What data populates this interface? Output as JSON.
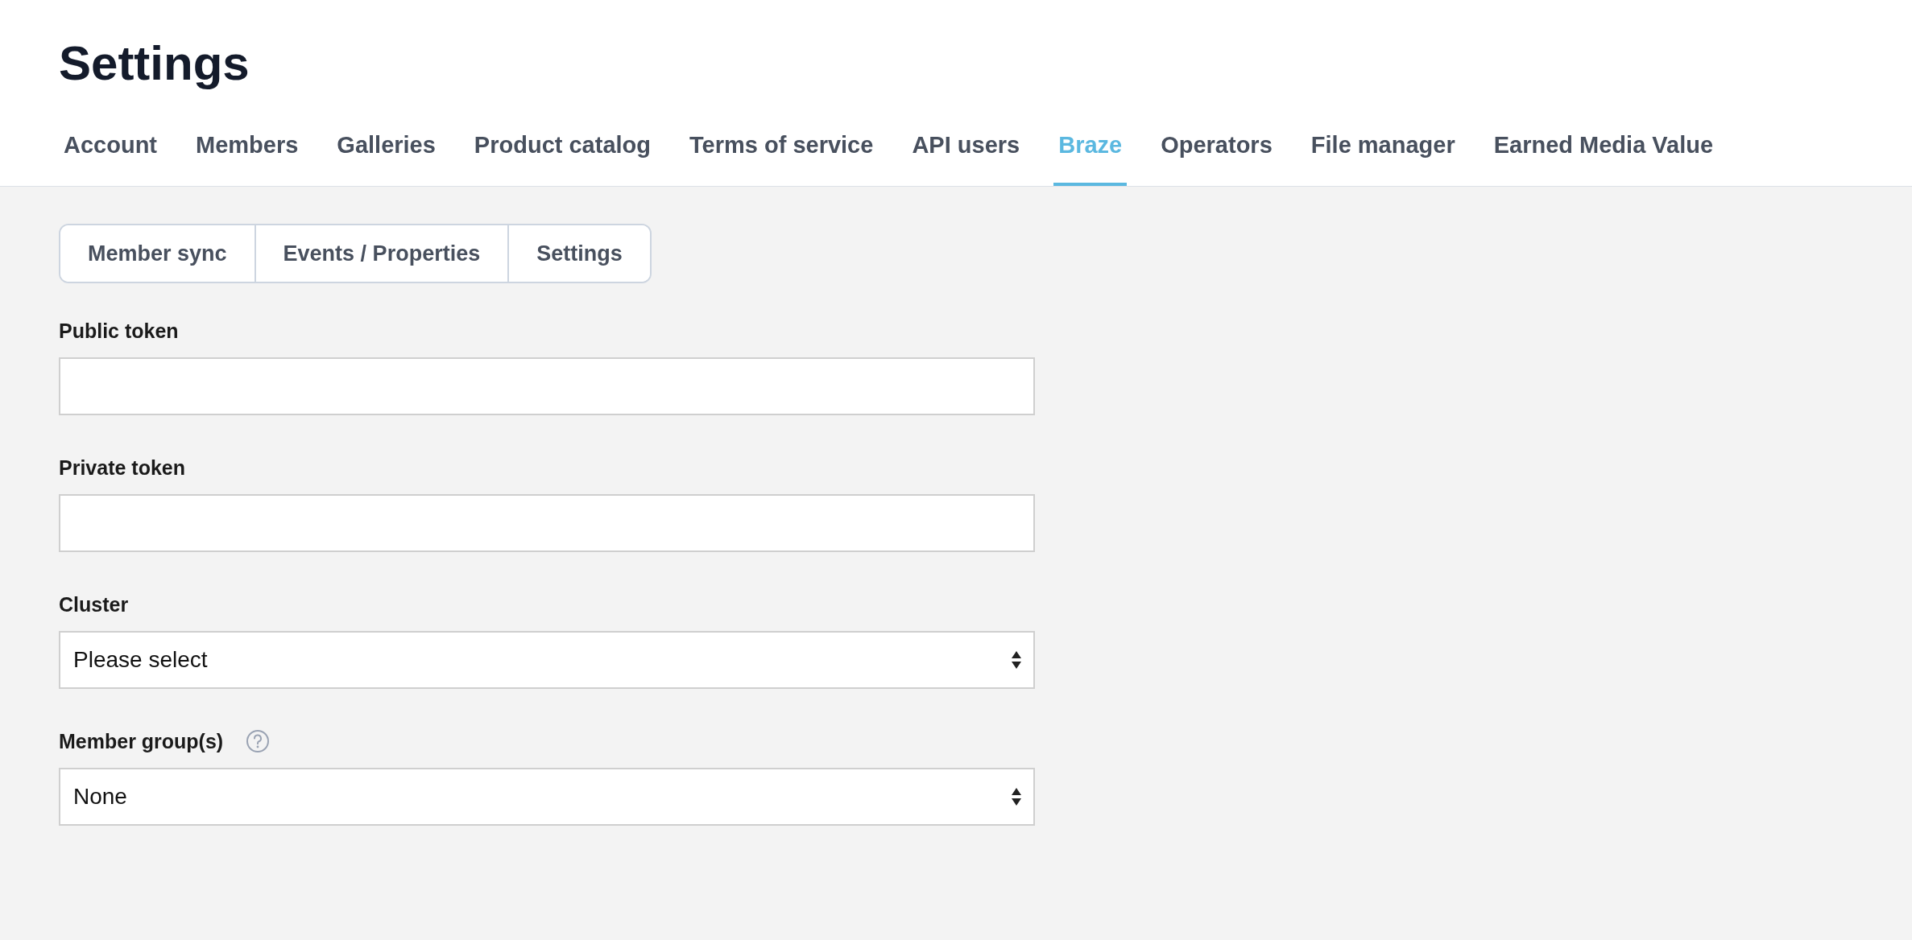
{
  "page": {
    "title": "Settings"
  },
  "tabs": [
    {
      "label": "Account",
      "selected": false
    },
    {
      "label": "Members",
      "selected": false
    },
    {
      "label": "Galleries",
      "selected": false
    },
    {
      "label": "Product catalog",
      "selected": false
    },
    {
      "label": "Terms of service",
      "selected": false
    },
    {
      "label": "API users",
      "selected": false
    },
    {
      "label": "Braze",
      "selected": true
    },
    {
      "label": "Operators",
      "selected": false
    },
    {
      "label": "File manager",
      "selected": false
    },
    {
      "label": "Earned Media Value",
      "selected": false
    }
  ],
  "subtabs": [
    "Member sync",
    "Events / Properties",
    "Settings"
  ],
  "fields": [
    {
      "kind": "text",
      "label": "Public token"
    },
    {
      "kind": "text",
      "label": "Private token"
    },
    {
      "kind": "select",
      "label": "Cluster",
      "value": "Please select"
    },
    {
      "kind": "select",
      "label": "Member group(s)",
      "help": true,
      "value": "None"
    }
  ]
}
